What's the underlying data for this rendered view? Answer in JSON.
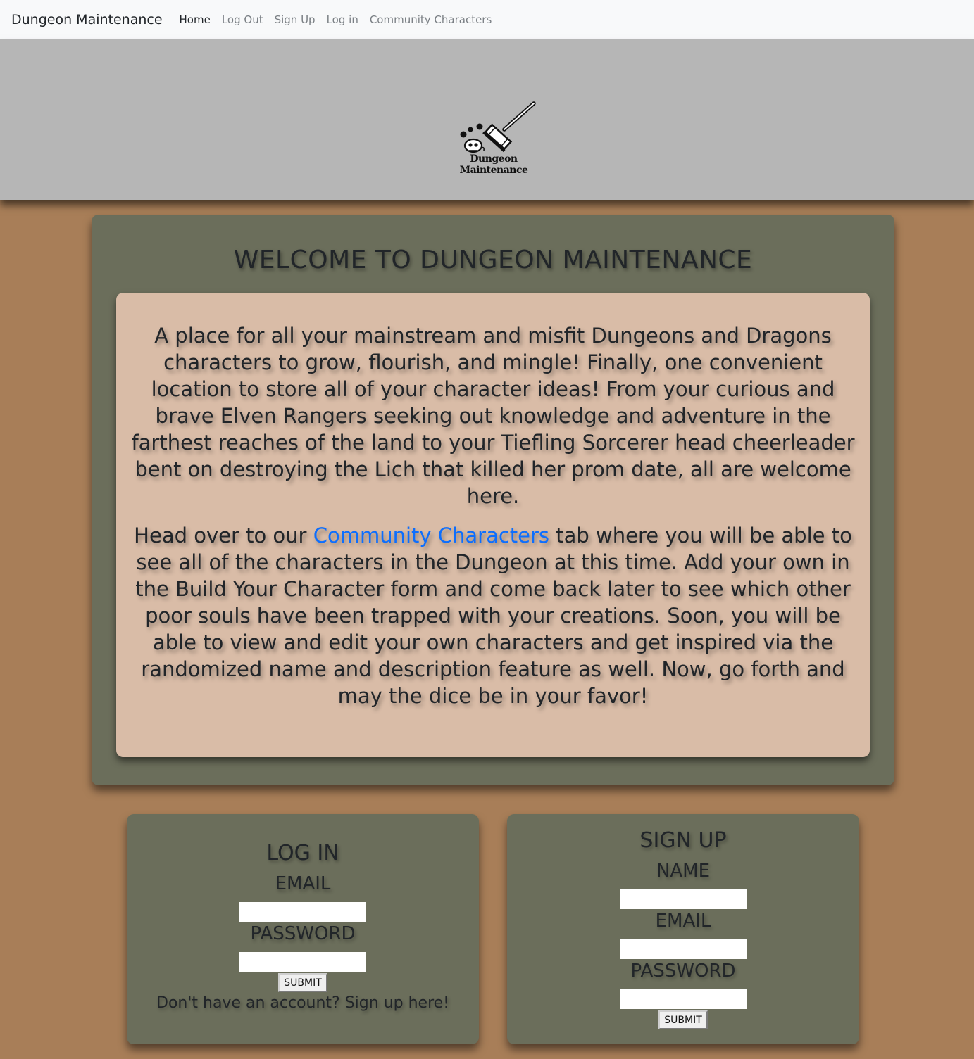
{
  "navbar": {
    "brand": "Dungeon Maintenance",
    "links": [
      "Home",
      "Log Out",
      "Sign Up",
      "Log in",
      "Community Characters"
    ]
  },
  "header": {
    "logo_text": "Dungeon Maintenance",
    "logo_icon": "broom-and-skull-icon"
  },
  "welcome": {
    "title": "WELCOME TO DUNGEON MAINTENANCE",
    "paragraph1": "A place for all your mainstream and misfit Dungeons and Dragons characters to grow, flourish, and mingle! Finally, one convenient location to store all of your character ideas! From your curious and brave Elven Rangers seeking out knowledge and adventure in the farthest reaches of the land to your Tiefling Sorcerer head cheerleader bent on destroying the Lich that killed her prom date, all are welcome here.",
    "paragraph2_before": "Head over to our ",
    "paragraph2_link": "Community Characters",
    "paragraph2_after": " tab where you will be able to see all of the characters in the Dungeon at this time. Add your own in the Build Your Character form and come back later to see which other poor souls have been trapped with your creations. Soon, you will be able to view and edit your own characters and get inspired via the randomized name and description feature as well. Now, go forth and may the dice be in your favor!"
  },
  "login": {
    "title": "LOG IN",
    "email_label": "EMAIL",
    "email_value": "",
    "password_label": "PASSWORD",
    "password_value": "",
    "submit": "SUBMIT",
    "signup_hint": "Don't have an account? Sign up here!"
  },
  "signup": {
    "title": "SIGN UP",
    "name_label": "NAME",
    "name_value": "",
    "email_label": "EMAIL",
    "email_value": "",
    "password_label": "PASSWORD",
    "password_value": "",
    "submit": "SUBMIT"
  },
  "colors": {
    "page_bg": "#a87e58",
    "header_bg": "#b6b6b6",
    "panel_bg": "#6b6e5b",
    "inner_bg": "#d9bca7",
    "link": "#0d6efd"
  }
}
